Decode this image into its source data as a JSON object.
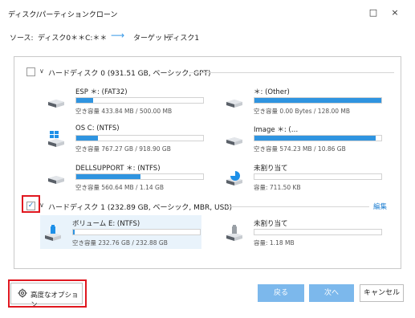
{
  "window": {
    "title": "ディスク/パーティションクローン",
    "controls": [
      "□",
      "×"
    ]
  },
  "path": {
    "source_label": "ソース:",
    "source_value": "ディスク0＊＊C:＊＊",
    "arrow": "⟶",
    "target_label": "ターゲット:",
    "target_value": "ディスク1"
  },
  "disks": [
    {
      "title": "ハードディスク 0 (931.51 GB, ベーシック, GPT)",
      "checked": false,
      "partitions": [
        {
          "name": "ESP ＊: (FAT32)",
          "capacity": "空き容量 433.84 MB / 500.00 MB",
          "used_fraction": 0.13,
          "icon": "drive-icon"
        },
        {
          "name": "＊: (Other)",
          "capacity": "空き容量 0.00 Bytes / 128.00 MB",
          "used_fraction": 1.0,
          "icon": "drive-icon"
        },
        {
          "name": "OS C: (NTFS)",
          "capacity": "空き容量 767.27 GB / 918.90 GB",
          "used_fraction": 0.17,
          "icon": "windows-drive-icon"
        },
        {
          "name": "Image ＊: (…",
          "capacity": "空き容量 574.23 MB / 10.86 GB",
          "used_fraction": 0.95,
          "icon": "drive-icon"
        },
        {
          "name": "DELLSUPPORT ＊: (NTFS)",
          "capacity": "空き容量 560.64 MB / 1.14 GB",
          "used_fraction": 0.51,
          "icon": "drive-icon"
        },
        {
          "name": "未割り当て",
          "capacity": "容量: 711.50 KB",
          "used_fraction": 0.0,
          "icon": "unallocated-drive-icon"
        }
      ]
    },
    {
      "title": "ハードディスク 1 (232.89 GB, ベーシック, MBR, USB)",
      "checked": true,
      "edit_label": "編集",
      "partitions": [
        {
          "name": "ボリューム E: (NTFS)",
          "capacity": "空き容量 232.76 GB / 232.88 GB",
          "used_fraction": 0.01,
          "icon": "usb-drive-icon"
        },
        {
          "name": "未割り当て",
          "capacity": "容量: 1.18 MB",
          "used_fraction": 0.0,
          "icon": "usb-unallocated-icon"
        }
      ]
    }
  ],
  "footer": {
    "advanced_label": "高度なオプション",
    "back_label": "戻る",
    "next_label": "次へ",
    "cancel_label": "キャンセル"
  },
  "colors": {
    "accent": "#2f94e0",
    "primary_button": "#7cb8ec",
    "highlight": "#e0171f",
    "selected_bg": "#e9f3fb"
  }
}
